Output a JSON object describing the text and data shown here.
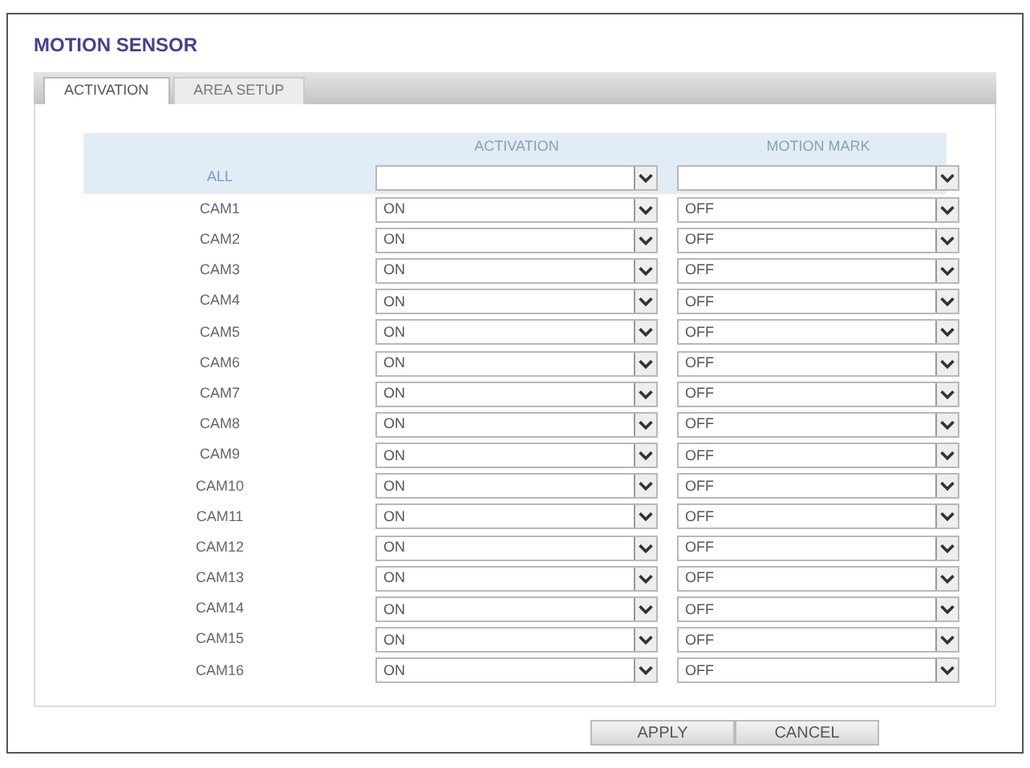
{
  "title": "MOTION SENSOR",
  "tabs": [
    {
      "label": "ACTIVATION",
      "selected": true
    },
    {
      "label": "AREA SETUP",
      "selected": false
    }
  ],
  "table": {
    "columns": [
      "ACTIVATION",
      "MOTION MARK"
    ],
    "rows": [
      {
        "kind": "all",
        "label": "ALL"
      },
      {
        "kind": "cam",
        "label": "CAM1",
        "activation": "ON",
        "motion_mark": "OFF"
      },
      {
        "kind": "cam",
        "label": "CAM2",
        "activation": "ON",
        "motion_mark": "OFF"
      },
      {
        "kind": "cam",
        "label": "CAM3",
        "activation": "ON",
        "motion_mark": "OFF"
      },
      {
        "kind": "cam",
        "label": "CAM4",
        "activation": "ON",
        "motion_mark": "OFF"
      },
      {
        "kind": "cam",
        "label": "CAM5",
        "activation": "ON",
        "motion_mark": "OFF"
      },
      {
        "kind": "cam",
        "label": "CAM6",
        "activation": "ON",
        "motion_mark": "OFF"
      },
      {
        "kind": "cam",
        "label": "CAM7",
        "activation": "ON",
        "motion_mark": "OFF"
      },
      {
        "kind": "cam",
        "label": "CAM8",
        "activation": "ON",
        "motion_mark": "OFF"
      },
      {
        "kind": "cam",
        "label": "CAM9",
        "activation": "ON",
        "motion_mark": "OFF"
      },
      {
        "kind": "cam",
        "label": "CAM10",
        "activation": "ON",
        "motion_mark": "OFF"
      },
      {
        "kind": "cam",
        "label": "CAM11",
        "activation": "ON",
        "motion_mark": "OFF"
      },
      {
        "kind": "cam",
        "label": "CAM12",
        "activation": "ON",
        "motion_mark": "OFF"
      },
      {
        "kind": "cam",
        "label": "CAM13",
        "activation": "ON",
        "motion_mark": "OFF"
      },
      {
        "kind": "cam",
        "label": "CAM14",
        "activation": "ON",
        "motion_mark": "OFF"
      },
      {
        "kind": "cam",
        "label": "CAM15",
        "activation": "ON",
        "motion_mark": "OFF"
      },
      {
        "kind": "cam",
        "label": "CAM16",
        "activation": "ON",
        "motion_mark": "OFF"
      }
    ]
  },
  "buttons": [
    "APPLY",
    "CANCEL"
  ]
}
